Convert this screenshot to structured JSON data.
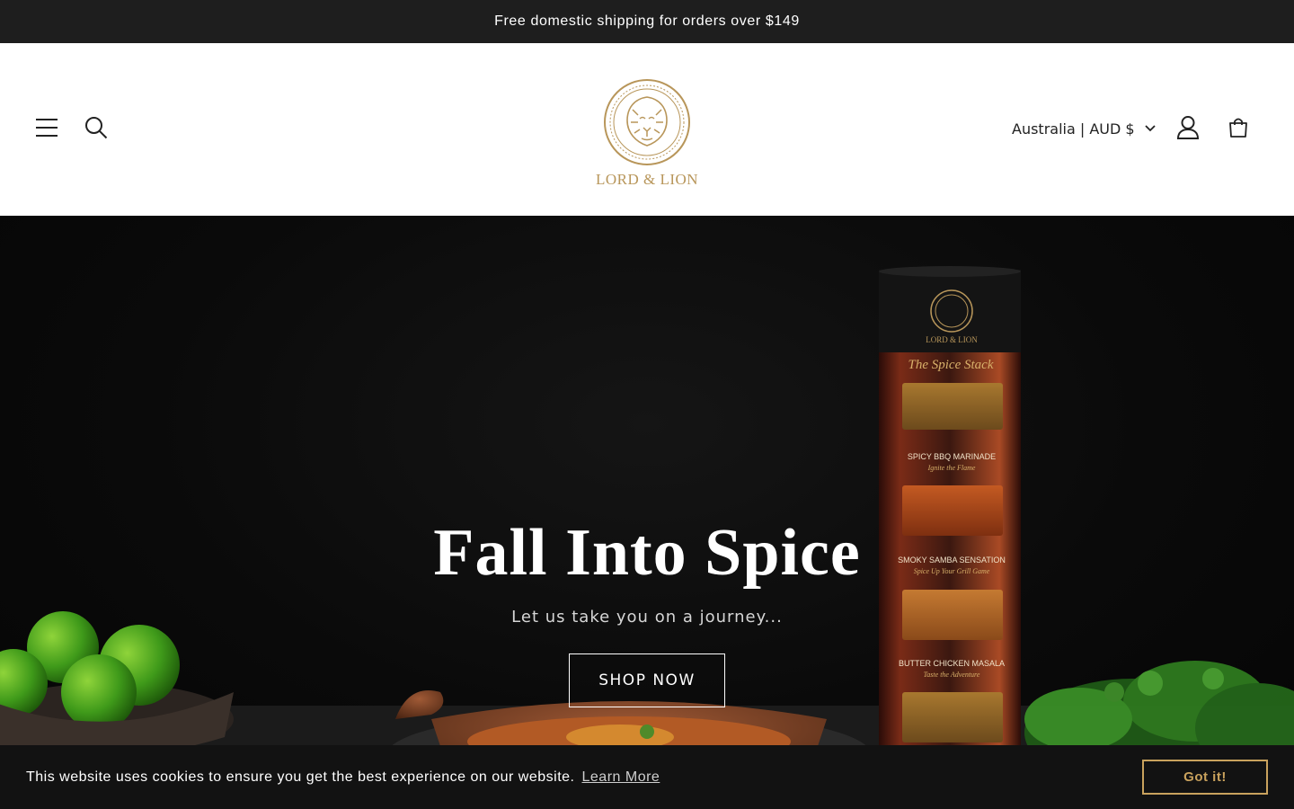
{
  "announcement": {
    "text": "Free domestic shipping for orders over $149"
  },
  "header": {
    "brand": "LORD & LION",
    "country_selector": "Australia | AUD $",
    "icons": {
      "menu": "menu-icon",
      "search": "search-icon",
      "account": "account-icon",
      "cart": "cart-icon",
      "chevron": "chevron-down-icon"
    }
  },
  "hero": {
    "title": "Fall Into Spice",
    "subtitle": "Let us take you on a journey...",
    "cta": "SHOP NOW",
    "product": {
      "brand": "LORD & LION",
      "name": "The Spice Stack",
      "flavors": [
        {
          "name": "SPICY BBQ MARINADE",
          "tagline": "Ignite the Flame"
        },
        {
          "name": "SMOKY SAMBA SENSATION",
          "tagline": "Spice Up Your Grill Game"
        },
        {
          "name": "BUTTER CHICKEN MASALA",
          "tagline": "Taste the Adventure"
        }
      ]
    }
  },
  "cookie_banner": {
    "text": "This website uses cookies to ensure you get the best experience on our website.",
    "link": "Learn More",
    "button": "Got it!"
  },
  "colors": {
    "announcement_bg": "#1e1e1e",
    "brand_gold": "#b8965a",
    "cookie_accent": "#c9a25d",
    "hero_bg": "#0a0a0a"
  }
}
